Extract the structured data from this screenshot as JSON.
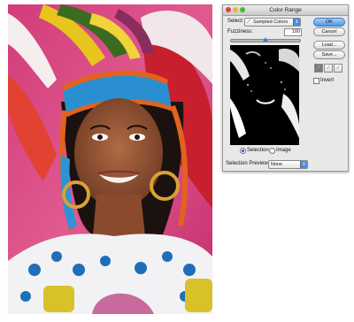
{
  "dialog": {
    "title": "Color Range",
    "select_label": "Select:",
    "select_value": "Sampled Colors",
    "fuzziness_label": "Fuzziness:",
    "fuzziness_value": "100",
    "fuzziness_level": 0.5,
    "ok_label": "OK",
    "cancel_label": "Cancel",
    "load_label": "Load...",
    "save_label": "Save...",
    "invert_label": "Invert",
    "selection_radio_label": "Selection",
    "image_radio_label": "Image",
    "selection_preview_label": "Selection Preview:",
    "selection_preview_value": "None"
  },
  "colors": {
    "accent": "#4b97ea",
    "close": "#e0443c",
    "minimize": "#e8b52f",
    "zoom": "#4fb33f"
  }
}
